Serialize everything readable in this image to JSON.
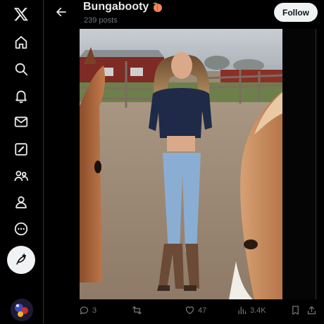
{
  "nav": {
    "items": [
      {
        "icon": "x-logo-icon"
      },
      {
        "icon": "home-icon"
      },
      {
        "icon": "search-icon"
      },
      {
        "icon": "notifications-icon"
      },
      {
        "icon": "messages-icon"
      },
      {
        "icon": "grok-icon"
      },
      {
        "icon": "communities-icon"
      },
      {
        "icon": "profile-icon"
      },
      {
        "icon": "more-icon"
      }
    ],
    "compose_icon": "compose-post-icon"
  },
  "header": {
    "name": "Bungabooty",
    "name_emoji": "peach-emoji",
    "posts_count": "239 posts",
    "follow_label": "Follow"
  },
  "media": {
    "description_icon": "photo"
  },
  "actions": {
    "replies": "3",
    "reposts": "",
    "likes": "47",
    "views": "3.4K"
  },
  "colors": {
    "background": "#000000",
    "text": "#e7e9ea",
    "muted": "#71767b",
    "follow_bg": "#eff3f4"
  }
}
